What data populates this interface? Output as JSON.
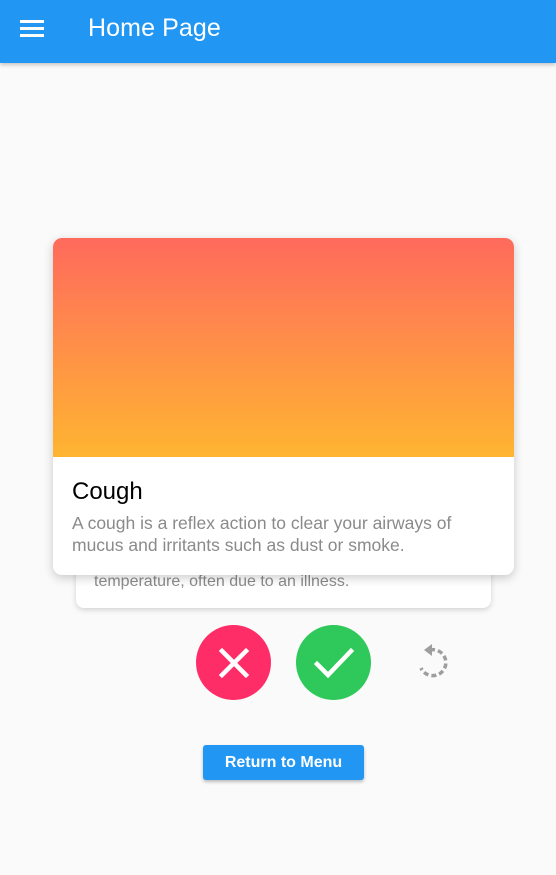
{
  "app_bar": {
    "title": "Home Page",
    "menu_icon": "hamburger-menu-icon",
    "background_color": "#2196f3"
  },
  "card_front": {
    "title": "Cough",
    "description": "A cough is a reflex action to clear your airways of mucus and irritants such as dust or smoke.",
    "gradient": [
      "#ff6a5c",
      "#ffb531"
    ]
  },
  "card_back": {
    "description_visible_fragment": "temperature, often due to an illness."
  },
  "actions": {
    "reject_icon": "close-icon",
    "reject_color": "#ff2d67",
    "accept_icon": "check-icon",
    "accept_color": "#2ec95a",
    "undo_icon": "undo-icon"
  },
  "return_button": {
    "label": "Return to Menu"
  }
}
